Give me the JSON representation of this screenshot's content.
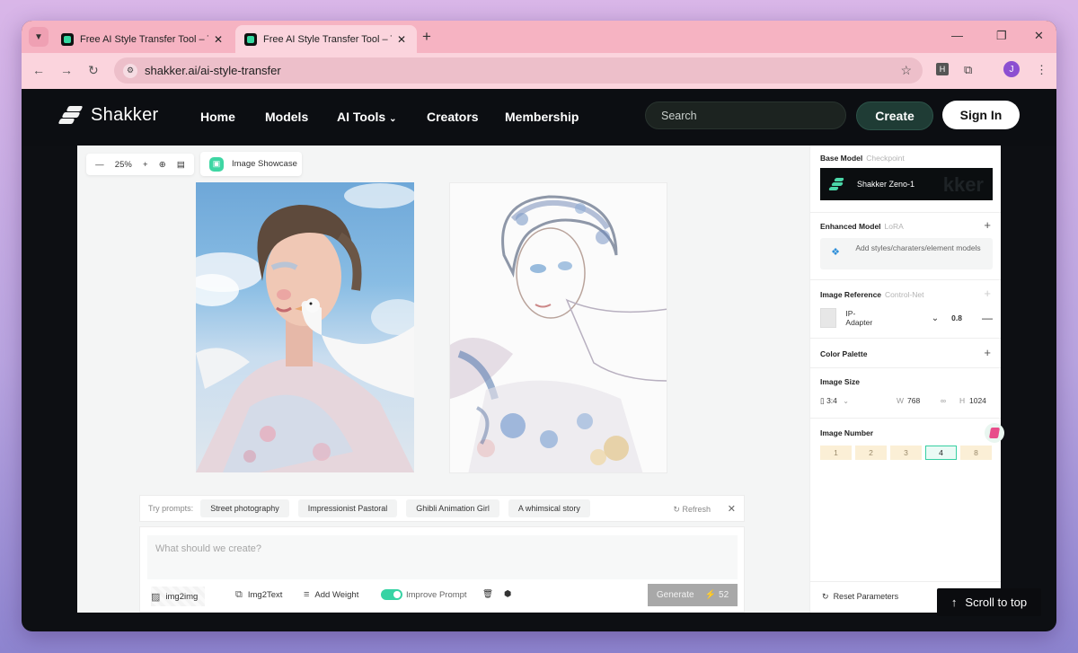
{
  "browser": {
    "tabs": [
      {
        "title": "Free AI Style Transfer Tool – Tran"
      },
      {
        "title": "Free AI Style Transfer Tool – Tran"
      }
    ],
    "url": "shakker.ai/ai-style-transfer",
    "profile_initial": "J",
    "extension_letter": "H"
  },
  "site": {
    "brand": "Shakker",
    "nav": [
      "Home",
      "Models",
      "AI Tools",
      "Creators",
      "Membership"
    ],
    "search_placeholder": "Search",
    "create_label": "Create",
    "signin_label": "Sign In"
  },
  "canvas": {
    "zoom": "25%",
    "showcase_label": "Image Showcase"
  },
  "prompts": {
    "label": "Try prompts:",
    "chips": [
      "Street photography",
      "Impressionist Pastoral",
      "Ghibli Animation Girl",
      "A whimsical story"
    ],
    "refresh_label": "Refresh"
  },
  "composer": {
    "placeholder": "What should we create?",
    "img2img": "img2img",
    "img2text": "Img2Text",
    "add_weight": "Add Weight",
    "improve_prompt": "Improve Prompt",
    "generate_label": "Generate",
    "generate_cost": "52"
  },
  "panel": {
    "base_model": {
      "title": "Base Model",
      "sub": "Checkpoint",
      "name": "Shakker Zeno-1",
      "watermark": "kker"
    },
    "enhanced_model": {
      "title": "Enhanced Model",
      "sub": "LoRA",
      "placeholder": "Add styles/charaters/element models"
    },
    "image_reference": {
      "title": "Image Reference",
      "sub": "Control-Net",
      "adapter": "IP-Adapter",
      "weight": "0.8"
    },
    "color_palette": {
      "title": "Color Palette"
    },
    "image_size": {
      "title": "Image Size",
      "ratio": "3:4",
      "w_label": "W",
      "width": "768",
      "h_label": "H",
      "height": "1024"
    },
    "image_number": {
      "title": "Image Number",
      "options": [
        "1",
        "2",
        "3",
        "4",
        "8"
      ],
      "selected": "4"
    },
    "reset_label": "Reset Parameters"
  },
  "scroll_to_top": "Scroll to top",
  "colors": {
    "accent": "#37d3a4",
    "header_bg": "#0c0e12",
    "tab_strip": "#f6b3c2"
  }
}
